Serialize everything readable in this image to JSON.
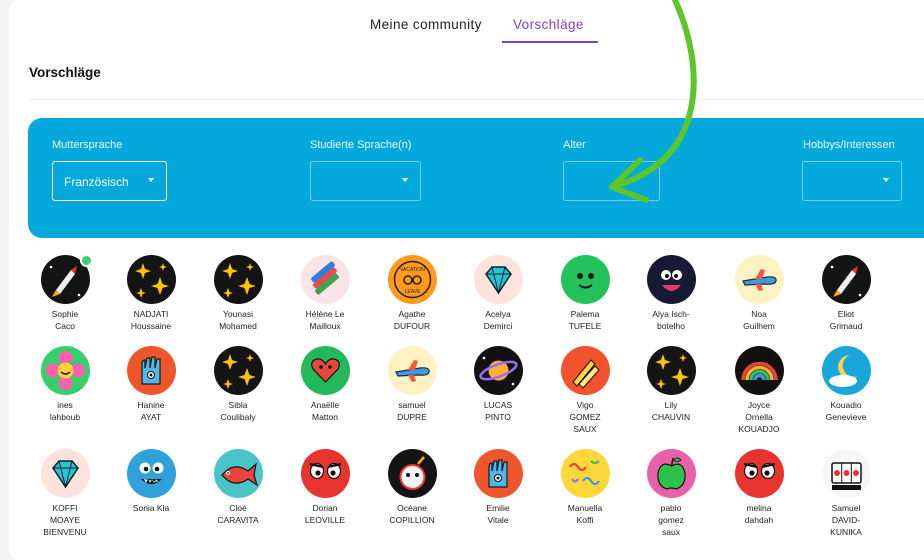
{
  "tabs": [
    {
      "label": "Meine community",
      "active": false
    },
    {
      "label": "Vorschläge",
      "active": true
    }
  ],
  "section_title": "Vorschläge",
  "filters": [
    {
      "label": "Muttersprache",
      "value": "Französisch"
    },
    {
      "label": "Studierte Sprache(n)",
      "value": ""
    },
    {
      "label": "Alter",
      "value": ""
    },
    {
      "label": "Hobbys/Interessen",
      "value": ""
    }
  ],
  "colors": {
    "accent": "#7b3fd6",
    "panel": "#05a8db",
    "arrow": "#5ac62a",
    "online": "#3dd06a"
  },
  "users": [
    {
      "name": [
        "Sophie",
        "Caco"
      ],
      "avatar": "rocket-icon",
      "online": true
    },
    {
      "name": [
        "NADJATI",
        "Houssaine"
      ],
      "avatar": "stars-icon"
    },
    {
      "name": [
        "Younasi",
        "Mohamed"
      ],
      "avatar": "stars-icon"
    },
    {
      "name": [
        "Hélène Le",
        "Mailloux"
      ],
      "avatar": "pencils-icon"
    },
    {
      "name": [
        "Agathe",
        "DUFOUR"
      ],
      "avatar": "vacation-badge-icon"
    },
    {
      "name": [
        "Acelya",
        "Demirci"
      ],
      "avatar": "diamond-icon"
    },
    {
      "name": [
        "Palema",
        "TUFELE"
      ],
      "avatar": "green-face-icon"
    },
    {
      "name": [
        "Alya Isch-",
        "botelho"
      ],
      "avatar": "cartoon-mouth-icon"
    },
    {
      "name": [
        "Noa",
        "Guilhem"
      ],
      "avatar": "airplane-icon"
    },
    {
      "name": [
        "Eliot",
        "Grimaud"
      ],
      "avatar": "rocket-icon"
    },
    {
      "name": [
        "ines",
        "lahboub"
      ],
      "avatar": "flower-icon"
    },
    {
      "name": [
        "Hanine",
        "AYAT"
      ],
      "avatar": "hamsa-hand-icon"
    },
    {
      "name": [
        "Sibla",
        "Coulibaly"
      ],
      "avatar": "stars-icon"
    },
    {
      "name": [
        "Anaëlle",
        "Matton"
      ],
      "avatar": "heart-character-icon"
    },
    {
      "name": [
        "samuel",
        "DUPRE"
      ],
      "avatar": "airplane-icon"
    },
    {
      "name": [
        "LUCAS",
        "PINTO"
      ],
      "avatar": "planet-icon"
    },
    {
      "name": [
        "Vigo",
        "GOMEZ",
        "SAUX"
      ],
      "avatar": "rockets-icon"
    },
    {
      "name": [
        "Lily",
        "CHAUVIN"
      ],
      "avatar": "stars-icon"
    },
    {
      "name": [
        "Joyce",
        "Ornella",
        "KOUADJO"
      ],
      "avatar": "rainbow-icon"
    },
    {
      "name": [
        "Kouadio",
        "Genevieve"
      ],
      "avatar": "moon-cloud-icon"
    },
    {
      "name": [
        "KOFFI",
        "MOAYE",
        "BIENVENU"
      ],
      "avatar": "diamond-icon"
    },
    {
      "name": [
        "Sonia Kla"
      ],
      "avatar": "blue-monster-icon"
    },
    {
      "name": [
        "Cloé",
        "CARAVITA"
      ],
      "avatar": "fish-icon"
    },
    {
      "name": [
        "Dorian",
        "LEOVILLE"
      ],
      "avatar": "red-eyes-icon"
    },
    {
      "name": [
        "Océane",
        "COPILLION"
      ],
      "avatar": "bomb-character-icon"
    },
    {
      "name": [
        "Emilie",
        "Vitale"
      ],
      "avatar": "hamsa-hand-icon"
    },
    {
      "name": [
        "Manuella",
        "Koffi"
      ],
      "avatar": "squiggles-icon"
    },
    {
      "name": [
        "pablo",
        "gomez",
        "saux"
      ],
      "avatar": "apple-icon"
    },
    {
      "name": [
        "melina",
        "dahdah"
      ],
      "avatar": "red-eyes-icon"
    },
    {
      "name": [
        "Samuel",
        "DAVID-",
        "KUNIKA"
      ],
      "avatar": "slot-machine-icon"
    }
  ]
}
